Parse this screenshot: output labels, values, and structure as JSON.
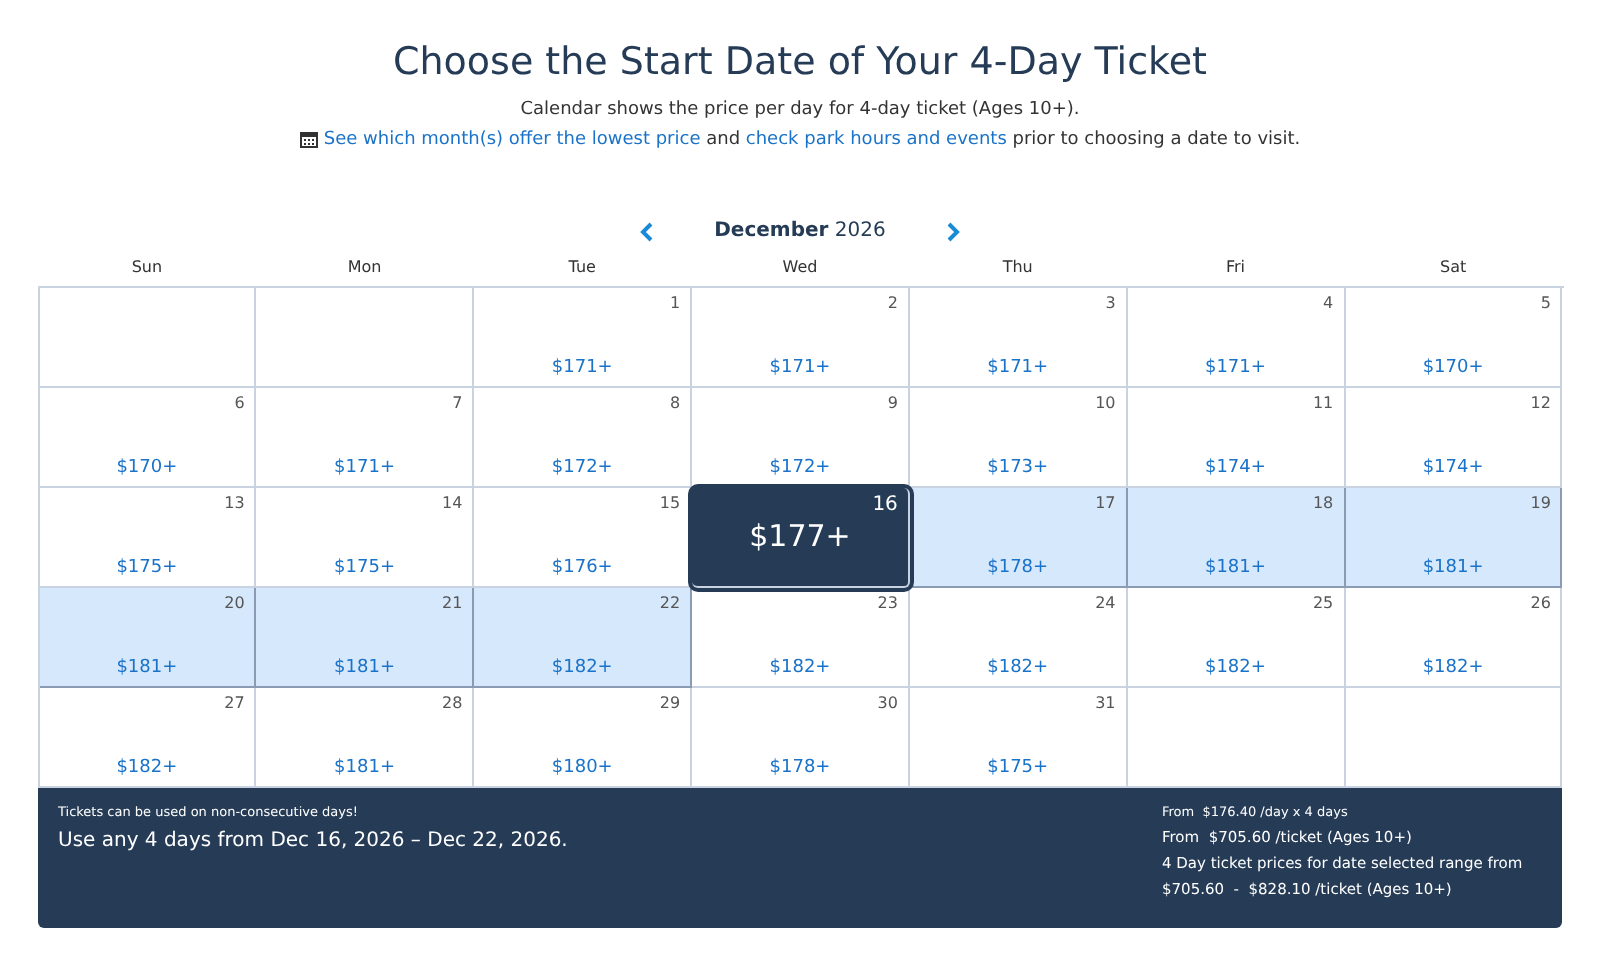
{
  "title": "Choose the Start Date of Your 4-Day Ticket",
  "subtitle": "Calendar shows the price per day for 4-day ticket (Ages 10+).",
  "info_line": [
    {
      "kind": "link",
      "text": "See which month(s) offer the lowest price"
    },
    {
      "kind": "text",
      "text": " and "
    },
    {
      "kind": "link",
      "text": "check park hours and events"
    },
    {
      "kind": "text",
      "text": " prior to choosing a date to visit."
    }
  ],
  "month_nav": {
    "month": "December",
    "year": "2026"
  },
  "weekdays": [
    "Sun",
    "Mon",
    "Tue",
    "Wed",
    "Thu",
    "Fri",
    "Sat"
  ],
  "days": [
    {
      "kind": "blank"
    },
    {
      "kind": "blank"
    },
    {
      "kind": "day",
      "day": "1",
      "price": "$171+",
      "selected": false,
      "in_range": false
    },
    {
      "kind": "day",
      "day": "2",
      "price": "$171+",
      "selected": false,
      "in_range": false
    },
    {
      "kind": "day",
      "day": "3",
      "price": "$171+",
      "selected": false,
      "in_range": false
    },
    {
      "kind": "day",
      "day": "4",
      "price": "$171+",
      "selected": false,
      "in_range": false
    },
    {
      "kind": "day",
      "day": "5",
      "price": "$170+",
      "selected": false,
      "in_range": false
    },
    {
      "kind": "day",
      "day": "6",
      "price": "$170+",
      "selected": false,
      "in_range": false
    },
    {
      "kind": "day",
      "day": "7",
      "price": "$171+",
      "selected": false,
      "in_range": false
    },
    {
      "kind": "day",
      "day": "8",
      "price": "$172+",
      "selected": false,
      "in_range": false
    },
    {
      "kind": "day",
      "day": "9",
      "price": "$172+",
      "selected": false,
      "in_range": false
    },
    {
      "kind": "day",
      "day": "10",
      "price": "$173+",
      "selected": false,
      "in_range": false
    },
    {
      "kind": "day",
      "day": "11",
      "price": "$174+",
      "selected": false,
      "in_range": false
    },
    {
      "kind": "day",
      "day": "12",
      "price": "$174+",
      "selected": false,
      "in_range": false
    },
    {
      "kind": "day",
      "day": "13",
      "price": "$175+",
      "selected": false,
      "in_range": false
    },
    {
      "kind": "day",
      "day": "14",
      "price": "$175+",
      "selected": false,
      "in_range": false
    },
    {
      "kind": "day",
      "day": "15",
      "price": "$176+",
      "selected": false,
      "in_range": false
    },
    {
      "kind": "day",
      "day": "16",
      "price": "$177+",
      "selected": true,
      "in_range": false
    },
    {
      "kind": "day",
      "day": "17",
      "price": "$178+",
      "selected": false,
      "in_range": true
    },
    {
      "kind": "day",
      "day": "18",
      "price": "$181+",
      "selected": false,
      "in_range": true
    },
    {
      "kind": "day",
      "day": "19",
      "price": "$181+",
      "selected": false,
      "in_range": true
    },
    {
      "kind": "day",
      "day": "20",
      "price": "$181+",
      "selected": false,
      "in_range": true
    },
    {
      "kind": "day",
      "day": "21",
      "price": "$181+",
      "selected": false,
      "in_range": true
    },
    {
      "kind": "day",
      "day": "22",
      "price": "$182+",
      "selected": false,
      "in_range": true
    },
    {
      "kind": "day",
      "day": "23",
      "price": "$182+",
      "selected": false,
      "in_range": false
    },
    {
      "kind": "day",
      "day": "24",
      "price": "$182+",
      "selected": false,
      "in_range": false
    },
    {
      "kind": "day",
      "day": "25",
      "price": "$182+",
      "selected": false,
      "in_range": false
    },
    {
      "kind": "day",
      "day": "26",
      "price": "$182+",
      "selected": false,
      "in_range": false
    },
    {
      "kind": "day",
      "day": "27",
      "price": "$182+",
      "selected": false,
      "in_range": false
    },
    {
      "kind": "day",
      "day": "28",
      "price": "$181+",
      "selected": false,
      "in_range": false
    },
    {
      "kind": "day",
      "day": "29",
      "price": "$180+",
      "selected": false,
      "in_range": false
    },
    {
      "kind": "day",
      "day": "30",
      "price": "$178+",
      "selected": false,
      "in_range": false
    },
    {
      "kind": "day",
      "day": "31",
      "price": "$175+",
      "selected": false,
      "in_range": false
    },
    {
      "kind": "blank"
    },
    {
      "kind": "blank"
    }
  ],
  "summary": {
    "note": "Tickets can be used on non-consecutive days!",
    "range": "Use any 4 days from Dec 16, 2026 – Dec 22, 2026.",
    "per_day": "From  $176.40 /day x 4 days",
    "per_ticket": "From  $705.60 /ticket (Ages 10+)",
    "range_label": "4 Day ticket prices for date selected range from",
    "price_range": "$705.60  -  $828.10 /ticket (Ages 10+)"
  }
}
